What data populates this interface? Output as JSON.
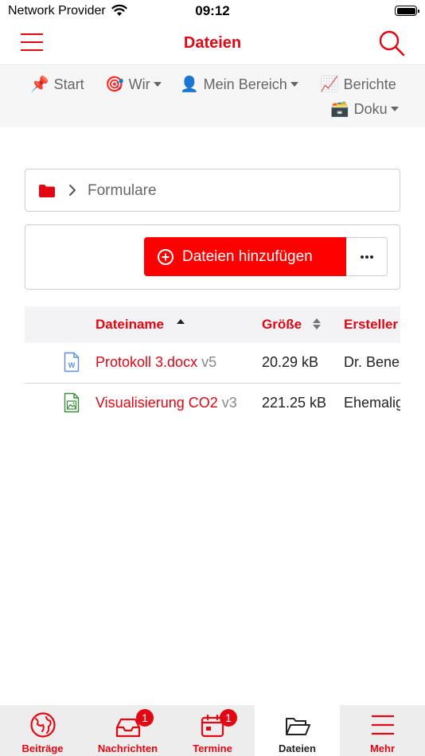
{
  "status": {
    "carrier": "Network Provider",
    "time": "09:12"
  },
  "nav": {
    "title": "Dateien"
  },
  "subnav": {
    "start": "Start",
    "wir": "Wir",
    "mein_bereich": "Mein Bereich",
    "berichte": "Berichte",
    "doku": "Doku"
  },
  "breadcrumb": {
    "current": "Formulare"
  },
  "actions": {
    "add_label": "Dateien hinzufügen",
    "more_label": "•••"
  },
  "table": {
    "headers": {
      "name": "Dateiname",
      "size": "Größe",
      "creator": "Ersteller"
    },
    "rows": [
      {
        "name": "Protokoll 3.docx",
        "version": "v5",
        "size": "20.29 kB",
        "creator": "Dr. Bene",
        "icon": "word-file-icon"
      },
      {
        "name": "Visualisierung CO2",
        "version": "v3",
        "size": "221.25 kB",
        "creator": "Ehemalig",
        "icon": "image-file-icon"
      }
    ]
  },
  "tabs": [
    {
      "label": "Beiträge",
      "icon": "globe-icon",
      "badge": ""
    },
    {
      "label": "Nachrichten",
      "icon": "inbox-icon",
      "badge": "1"
    },
    {
      "label": "Termine",
      "icon": "calendar-icon",
      "badge": "1"
    },
    {
      "label": "Dateien",
      "icon": "folder-open-icon",
      "badge": ""
    },
    {
      "label": "Mehr",
      "icon": "menu-icon",
      "badge": ""
    }
  ],
  "colors": {
    "accent": "#e30613",
    "button": "#ff0000",
    "tab_bar": "#ededed"
  }
}
